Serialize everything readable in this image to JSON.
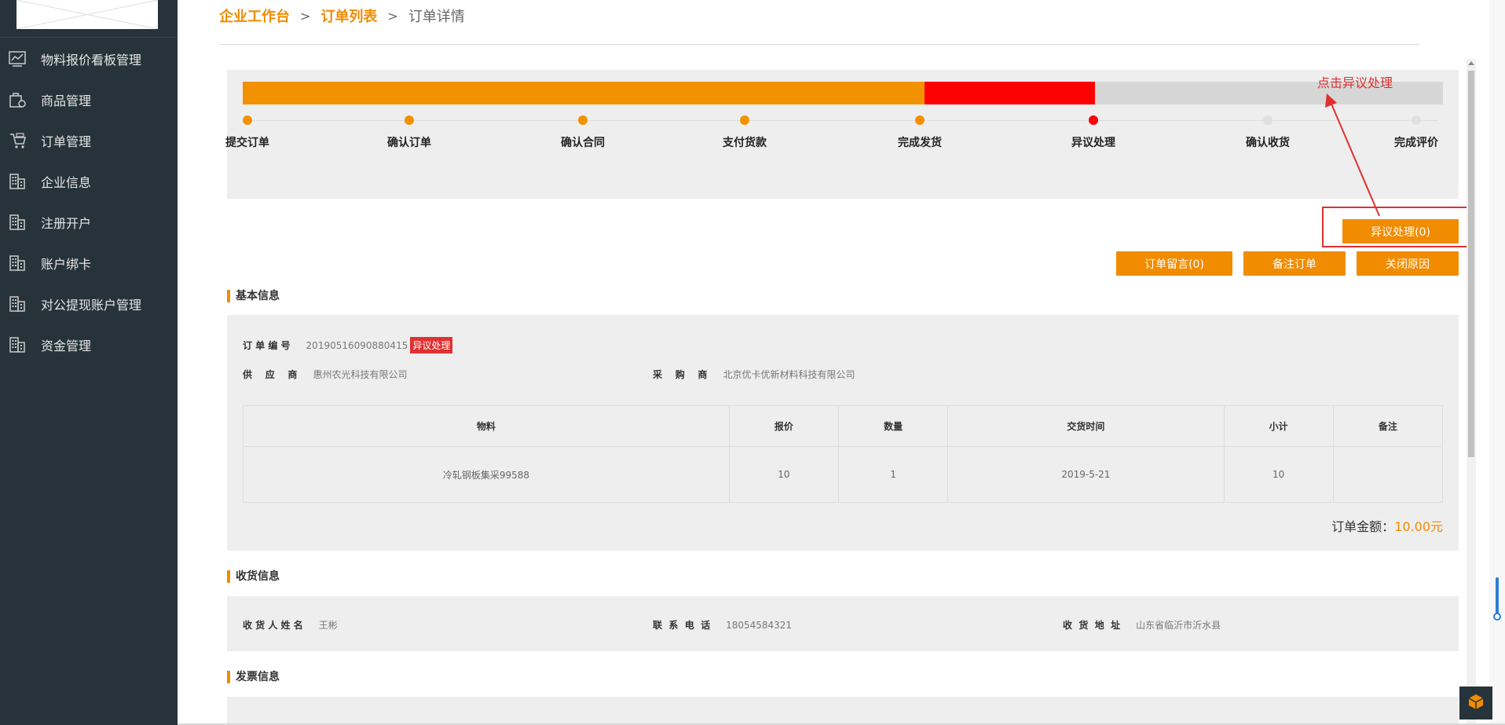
{
  "sidebar": {
    "items": [
      {
        "label": "物料报价看板管理",
        "icon": "chart-icon"
      },
      {
        "label": "商品管理",
        "icon": "goods-icon"
      },
      {
        "label": "订单管理",
        "icon": "order-icon"
      },
      {
        "label": "企业信息",
        "icon": "building-icon"
      },
      {
        "label": "注册开户",
        "icon": "building-icon"
      },
      {
        "label": "账户绑卡",
        "icon": "building-icon"
      },
      {
        "label": "对公提现账户管理",
        "icon": "building-icon"
      },
      {
        "label": "资金管理",
        "icon": "building-icon"
      }
    ]
  },
  "breadcrumb": {
    "home": "企业工作台",
    "sep": ">",
    "list": "订单列表",
    "current": "订单详情"
  },
  "progress": {
    "completed_fraction": 0.568,
    "dispute_fraction": 0.142,
    "colors": {
      "done": "#f39200",
      "dispute": "#ff0000",
      "pending": "#d6d6d6"
    },
    "steps": [
      {
        "label": "提交订单",
        "state": "done"
      },
      {
        "label": "确认订单",
        "state": "done"
      },
      {
        "label": "确认合同",
        "state": "done"
      },
      {
        "label": "支付货款",
        "state": "done"
      },
      {
        "label": "完成发货",
        "state": "done"
      },
      {
        "label": "异议处理",
        "state": "dispute"
      },
      {
        "label": "确认收货",
        "state": "pending"
      },
      {
        "label": "完成评价",
        "state": "pending"
      }
    ]
  },
  "annotation": {
    "text": "点击异议处理"
  },
  "buttons": {
    "dispute": "异议处理(0)",
    "message": "订单留言(0)",
    "remark": "备注订单",
    "close_reason": "关闭原因"
  },
  "basic_info": {
    "title": "基本信息",
    "order_no_label": "订 单 编 号",
    "order_no": "20190516090880415",
    "status_badge": "异议处理",
    "supplier_label": "供    应    商",
    "supplier": "惠州农光科技有限公司",
    "buyer_label": "采    购    商",
    "buyer": "北京优卡优新材料科技有限公司",
    "table": {
      "headers": [
        "物料",
        "报价",
        "数量",
        "交货时间",
        "小计",
        "备注"
      ],
      "rows": [
        [
          "冷轧钢板集采99588",
          "10",
          "1",
          "2019-5-21",
          "10",
          ""
        ]
      ]
    },
    "total_label": "订单金额：",
    "total_value": "10.00元"
  },
  "shipping": {
    "title": "收货信息",
    "name_label": "收 货 人 姓 名",
    "name": "王彬",
    "phone_label": "联  系  电  话",
    "phone": "18054584321",
    "address_label": "收  货  地  址",
    "address": "山东省临沂市沂水县"
  },
  "invoice": {
    "title": "发票信息"
  }
}
